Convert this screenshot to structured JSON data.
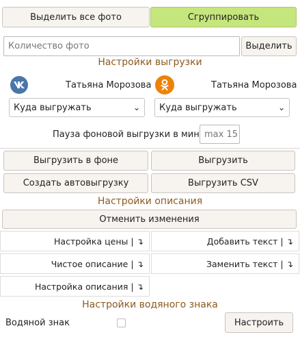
{
  "top": {
    "select_all": "Выделить все фото",
    "group": "Сгруппировать"
  },
  "count": {
    "placeholder": "Количество фото",
    "select": "Выделить"
  },
  "upload_settings": {
    "title": "Настройки выгрузки",
    "vk": {
      "user": "Татьяна Морозова",
      "target": "Куда выгружать"
    },
    "ok": {
      "user": "Татьяна Морозова",
      "target": "Куда выгружать"
    },
    "pause_label": "Пауза фоновой выгрузки в мин.",
    "pause_placeholder": "max 15",
    "btn_background": "Выгрузить в фоне",
    "btn_upload": "Выгрузить",
    "btn_auto": "Создать автовыгрузку",
    "btn_csv": "Выгрузить CSV"
  },
  "description_settings": {
    "title": "Настройки описания",
    "cancel": "Отменить изменения",
    "items": [
      "Настройка цены | ↴",
      "Добавить текст | ↴",
      "Чистое описание | ↴",
      "Заменить текст | ↴",
      "Настройка описания | ↴"
    ]
  },
  "watermark": {
    "title": "Настройки водяного знака",
    "label": "Водяной знак",
    "configure": "Настроить"
  },
  "colors": {
    "accent_green": "#c5e57d",
    "section_title": "#8c5a1f",
    "vk": "#4a76a8",
    "ok": "#ee8208"
  }
}
